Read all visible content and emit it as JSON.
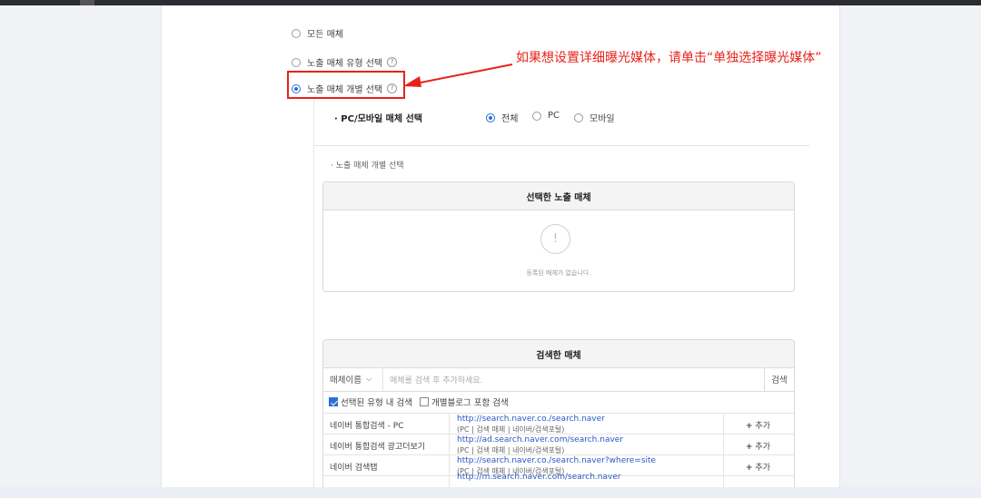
{
  "media_options": [
    {
      "label": "모든 매체",
      "selected": false,
      "help": false
    },
    {
      "label": "노출 매체 유형 선택",
      "selected": false,
      "help": true
    },
    {
      "label": "노출 매체 개별 선택",
      "selected": true,
      "help": true
    }
  ],
  "annotation": {
    "text": "如果想设置详细曝光媒体，请单击“单独选择曝光媒体”",
    "color": "#e8221a"
  },
  "device_selection": {
    "label": "· PC/모바일 매체 선택",
    "options": [
      {
        "label": "전체",
        "selected": true
      },
      {
        "label": "PC",
        "selected": false
      },
      {
        "label": "모바일",
        "selected": false
      }
    ]
  },
  "individual_label": "· 노출 매체 개별 선택",
  "selected_media": {
    "title": "선택한 노출 매체",
    "empty_icon": "!",
    "empty_text": "등록된 매체가 없습니다."
  },
  "searched_media": {
    "title": "검색한 매체",
    "search_select": "매체이름",
    "search_placeholder": "매체를 검색 후 추가하세요.",
    "search_button": "검색",
    "checkboxes": [
      {
        "label": "선택된 유형 내 검색",
        "checked": true
      },
      {
        "label": "개별블로그 포함 검색",
        "checked": false
      }
    ],
    "add_label": "추가",
    "rows": [
      {
        "name": "네이버 통합검색 - PC",
        "url": "http://search.naver.co./search.naver",
        "sub": "(PC | 검색 매체 | 네이버/검색포털)"
      },
      {
        "name": "네이버 통합검색 광고더보기",
        "url": "http://ad.search.naver.com/search.naver",
        "sub": "(PC | 검색 매체 | 네이버/검색포털)"
      },
      {
        "name": "네이버 검색탭",
        "url": "http://search.naver.co./search.naver?where=site",
        "sub": "(PC | 검색 매체 | 네이버/검색포털)"
      },
      {
        "name": "",
        "url": "http://m.search.naver.com/search.naver",
        "sub": ""
      }
    ]
  },
  "colors": {
    "accent": "#2a6fd6",
    "annotation_red": "#e8221a"
  }
}
